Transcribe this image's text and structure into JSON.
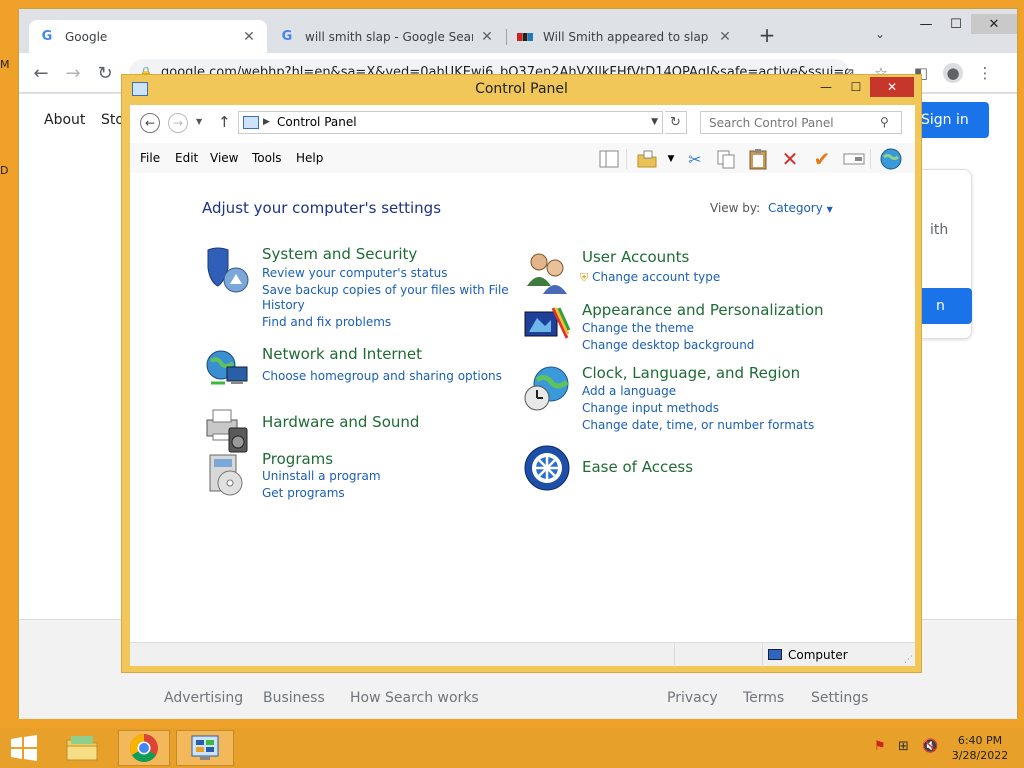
{
  "desktop": {
    "frag1": "M",
    "frag2": "D"
  },
  "chrome": {
    "tabs": [
      {
        "title": "Google",
        "close": "✕"
      },
      {
        "title": "will smith slap - Google Search",
        "close": "✕"
      },
      {
        "title": "Will Smith appeared to slap Chris",
        "close": "✕"
      }
    ],
    "new_tab": "+",
    "tab_search": "⌄",
    "window_controls": {
      "minimize": "—",
      "maximize": "☐",
      "close": "✕"
    },
    "nav": {
      "back": "←",
      "forward": "→",
      "reload": "↻"
    },
    "address": "google.com/webhp?hl=en&sa=X&ved=0ahUKEwi6_bO37en2AhVXIlkFHfVtD14QPAgI&safe=active&ssui=on",
    "page": {
      "top_links": [
        "About",
        "Sto"
      ],
      "sign_in": "Sign in",
      "card_text": "ith",
      "card_button": "n",
      "footer_links": [
        "Advertising",
        "Business",
        "How Search works",
        "Privacy",
        "Terms",
        "Settings"
      ]
    }
  },
  "control_panel": {
    "title": "Control Panel",
    "window_controls": {
      "minimize": "—",
      "maximize": "☐",
      "close": "✕"
    },
    "breadcrumb": "Control Panel",
    "search_placeholder": "Search Control Panel",
    "menu": [
      "File",
      "Edit",
      "View",
      "Tools",
      "Help"
    ],
    "heading": "Adjust your computer's settings",
    "view_by_label": "View by:",
    "view_by_value": "Category",
    "categories_left": [
      {
        "title": "System and Security",
        "links": [
          "Review your computer's status",
          "Save backup copies of your files with File",
          "History",
          "Find and fix problems"
        ]
      },
      {
        "title": "Network and Internet",
        "links": [
          "Choose homegroup and sharing options"
        ]
      },
      {
        "title": "Hardware and Sound",
        "links": []
      },
      {
        "title": "Programs",
        "links": [
          "Uninstall a program",
          "Get programs"
        ]
      }
    ],
    "categories_right": [
      {
        "title": "User Accounts",
        "links": [
          "Change account type"
        ]
      },
      {
        "title": "Appearance and Personalization",
        "links": [
          "Change the theme",
          "Change desktop background"
        ]
      },
      {
        "title": "Clock, Language, and Region",
        "links": [
          "Add a language",
          "Change input methods",
          "Change date, time, or number formats"
        ]
      },
      {
        "title": "Ease of Access",
        "links": []
      }
    ],
    "status_text": "Computer"
  },
  "taskbar": {
    "time": "6:40 PM",
    "date": "3/28/2022"
  },
  "colors": {
    "accent": "#1a73e8",
    "cp_link": "#1a5fb4",
    "cp_category": "#1e6b34",
    "taskbar": "#e7a02a"
  }
}
